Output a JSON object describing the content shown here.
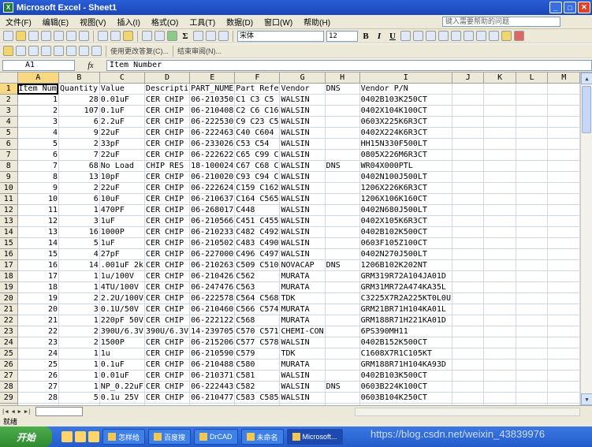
{
  "window": {
    "title": "Microsoft Excel - Sheet1"
  },
  "menu": {
    "items": [
      "文件(F)",
      "编辑(E)",
      "视图(V)",
      "插入(I)",
      "格式(O)",
      "工具(T)",
      "数据(D)",
      "窗口(W)",
      "帮助(H)"
    ],
    "help_placeholder": "键入需要帮助的问题"
  },
  "toolbar": {
    "font": "宋体",
    "size": "12",
    "bold": "B",
    "italic": "I",
    "underline": "U",
    "review_reply": "使用更改答复(C)...",
    "review_end": "结束审阅(N)..."
  },
  "formula": {
    "cell": "A1",
    "fx": "fx",
    "value": "Item Number"
  },
  "columns": [
    "A",
    "B",
    "C",
    "D",
    "E",
    "F",
    "G",
    "H",
    "I",
    "J",
    "K",
    "L",
    "M"
  ],
  "rows": [
    [
      "1",
      "Item Num",
      "Quantity",
      "Value",
      "Descripti",
      "PART_NUME",
      "Part Refe",
      "Vendor",
      "DNS",
      "Vendor P/N",
      "",
      "",
      "",
      ""
    ],
    [
      "2",
      "1",
      "28",
      "0.01uF",
      "CER CHIP",
      "06-210350",
      "C1 C3 C5",
      "WALSIN",
      "",
      "0402B103K250CT",
      "",
      "",
      "",
      ""
    ],
    [
      "3",
      "2",
      "107",
      "0.1uF",
      "CER CHIP",
      "06-210408",
      "C2 C6 C16",
      "WALSIN",
      "",
      "0402X104K100CT",
      "",
      "",
      "",
      ""
    ],
    [
      "4",
      "3",
      "6",
      "2.2uF",
      "CER CHIP",
      "06-222530",
      "C9 C23 C5",
      "WALSIN",
      "",
      "0603X225K6R3CT",
      "",
      "",
      "",
      ""
    ],
    [
      "5",
      "4",
      "9",
      "22uF",
      "CER CHIP",
      "06-222463",
      "C40 C604",
      "WALSIN",
      "",
      "0402X224K6R3CT",
      "",
      "",
      "",
      ""
    ],
    [
      "6",
      "5",
      "2",
      "33pF",
      "CER CHIP",
      "06-233026",
      "C53 C54",
      "WALSIN",
      "",
      "HH15N330F500LT",
      "",
      "",
      "",
      ""
    ],
    [
      "7",
      "6",
      "7",
      "22uF",
      "CER CHIP",
      "06-222622",
      "C65 C99 C",
      "WALSIN",
      "",
      "0805X226M6R3CT",
      "",
      "",
      "",
      ""
    ],
    [
      "8",
      "7",
      "68",
      "No Load",
      "CHIP RES",
      "18-100024",
      "C67 C68 C",
      "WALSIN",
      "DNS",
      "WR04X000PTL",
      "",
      "",
      "",
      ""
    ],
    [
      "9",
      "8",
      "13",
      "10pF",
      "CER CHIP",
      "06-210020",
      "C93 C94 C",
      "WALSIN",
      "",
      "0402N100J500LT",
      "",
      "",
      "",
      ""
    ],
    [
      "10",
      "9",
      "2",
      "22uF",
      "CER CHIP",
      "06-222624",
      "C159 C162",
      "WALSIN",
      "",
      "1206X226K6R3CT",
      "",
      "",
      "",
      ""
    ],
    [
      "11",
      "10",
      "6",
      "10uF",
      "CER CHIP",
      "06-210637",
      "C164 C565",
      "WALSIN",
      "",
      "1206X106K160CT",
      "",
      "",
      "",
      ""
    ],
    [
      "12",
      "11",
      "1",
      "470PF",
      "CER CHIP",
      "06-268017",
      "C448",
      "WALSIN",
      "",
      "0402N680J500LT",
      "",
      "",
      "",
      ""
    ],
    [
      "13",
      "12",
      "3",
      "1uF",
      "CER CHIP",
      "06-210566",
      "C451 C455",
      "WALSIN",
      "",
      "0402X105K6R3CT",
      "",
      "",
      "",
      ""
    ],
    [
      "14",
      "13",
      "16",
      "1000P",
      "CER CHIP",
      "06-210233",
      "C482 C492",
      "WALSIN",
      "",
      "0402B102K500CT",
      "",
      "",
      "",
      ""
    ],
    [
      "15",
      "14",
      "5",
      "1uF",
      "CER CHIP",
      "06-210502",
      "C483 C490",
      "WALSIN",
      "",
      "0603F105Z100CT",
      "",
      "",
      "",
      ""
    ],
    [
      "16",
      "15",
      "4",
      "27pF",
      "CER CHIP",
      "06-227000",
      "C496 C497",
      "WALSIN",
      "",
      "0402N270J500LT",
      "",
      "",
      "",
      ""
    ],
    [
      "17",
      "16",
      "14",
      ".001uF 2k",
      "CER CHIP",
      "06-210263",
      "C509 C510",
      "NOVACAP",
      "DNS",
      "1206B102K202NT",
      "",
      "",
      "",
      ""
    ],
    [
      "18",
      "17",
      "1",
      "1u/100V",
      "CER CHIP",
      "06-210426",
      "C562",
      "MURATA",
      "",
      "GRM319R72A104JA01D",
      "",
      "",
      "",
      ""
    ],
    [
      "19",
      "18",
      "1",
      "4TU/100V",
      "CER CHIP",
      "06-247476",
      "C563",
      "MURATA",
      "",
      "GRM31MR72A474KA35L",
      "",
      "",
      "",
      ""
    ],
    [
      "20",
      "19",
      "2",
      "2.2U/100V",
      "CER CHIP",
      "06-222578",
      "C564 C568",
      "TDK",
      "",
      "C3225X7R2A225KT0L0U",
      "",
      "",
      "",
      ""
    ],
    [
      "21",
      "20",
      "3",
      "0.1U/50V",
      "CER CHIP",
      "06-210460",
      "C566 C574",
      "MURATA",
      "",
      "GRM21BR71H104KA01L",
      "",
      "",
      "",
      ""
    ],
    [
      "22",
      "21",
      "1",
      "220pF 50V",
      "CER CHIP",
      "06-222122",
      "C568",
      "MURATA",
      "",
      "GRM188R71H221KA01D",
      "",
      "",
      "",
      ""
    ],
    [
      "23",
      "22",
      "2",
      "390U/6.3V",
      "390U/6.3V",
      "14-239705",
      "C570 C571",
      "CHEMI-CON",
      "",
      "6PS390MH11",
      "",
      "",
      "",
      ""
    ],
    [
      "24",
      "23",
      "2",
      "1500P",
      "CER CHIP",
      "06-215206",
      "C577 C578",
      "WALSIN",
      "",
      "0402B152K500CT",
      "",
      "",
      "",
      ""
    ],
    [
      "25",
      "24",
      "1",
      "1u",
      "CER CHIP",
      "06-210590",
      "C579",
      "TDK",
      "",
      "C1608X7R1C105KT",
      "",
      "",
      "",
      ""
    ],
    [
      "26",
      "25",
      "1",
      "0.1uF",
      "CER CHIP",
      "06-210488",
      "C580",
      "MURATA",
      "",
      "GRM188R71H104KA93D",
      "",
      "",
      "",
      ""
    ],
    [
      "27",
      "26",
      "1",
      "0.01uF",
      "CER CHIP",
      "06-210371",
      "C581",
      "WALSIN",
      "",
      "0402B103K500CT",
      "",
      "",
      "",
      ""
    ],
    [
      "28",
      "27",
      "1",
      "NP_0.22uF",
      "CER CHIP",
      "06-222443",
      "C582",
      "WALSIN",
      "DNS",
      "0603B224K100CT",
      "",
      "",
      "",
      ""
    ],
    [
      "29",
      "28",
      "5",
      "0.1u 25V",
      "CER CHIP",
      "06-210477",
      "C583 C585",
      "WALSIN",
      "",
      "0603B104K250CT",
      "",
      "",
      "",
      ""
    ],
    [
      "30",
      "29",
      "2",
      "0.2U 16V",
      "CER CHIP",
      "06-222596",
      "C584",
      "WALSIN",
      "",
      "1206B225K160CT",
      "",
      "",
      "",
      ""
    ]
  ],
  "status": {
    "text": "就绪"
  },
  "taskbar": {
    "start": "开始",
    "tasks": [
      "怎样给",
      "百度搜",
      "DrCAD",
      "未命名",
      "Microsoft..."
    ]
  },
  "watermark": "https://blog.csdn.net/weixin_43839976"
}
